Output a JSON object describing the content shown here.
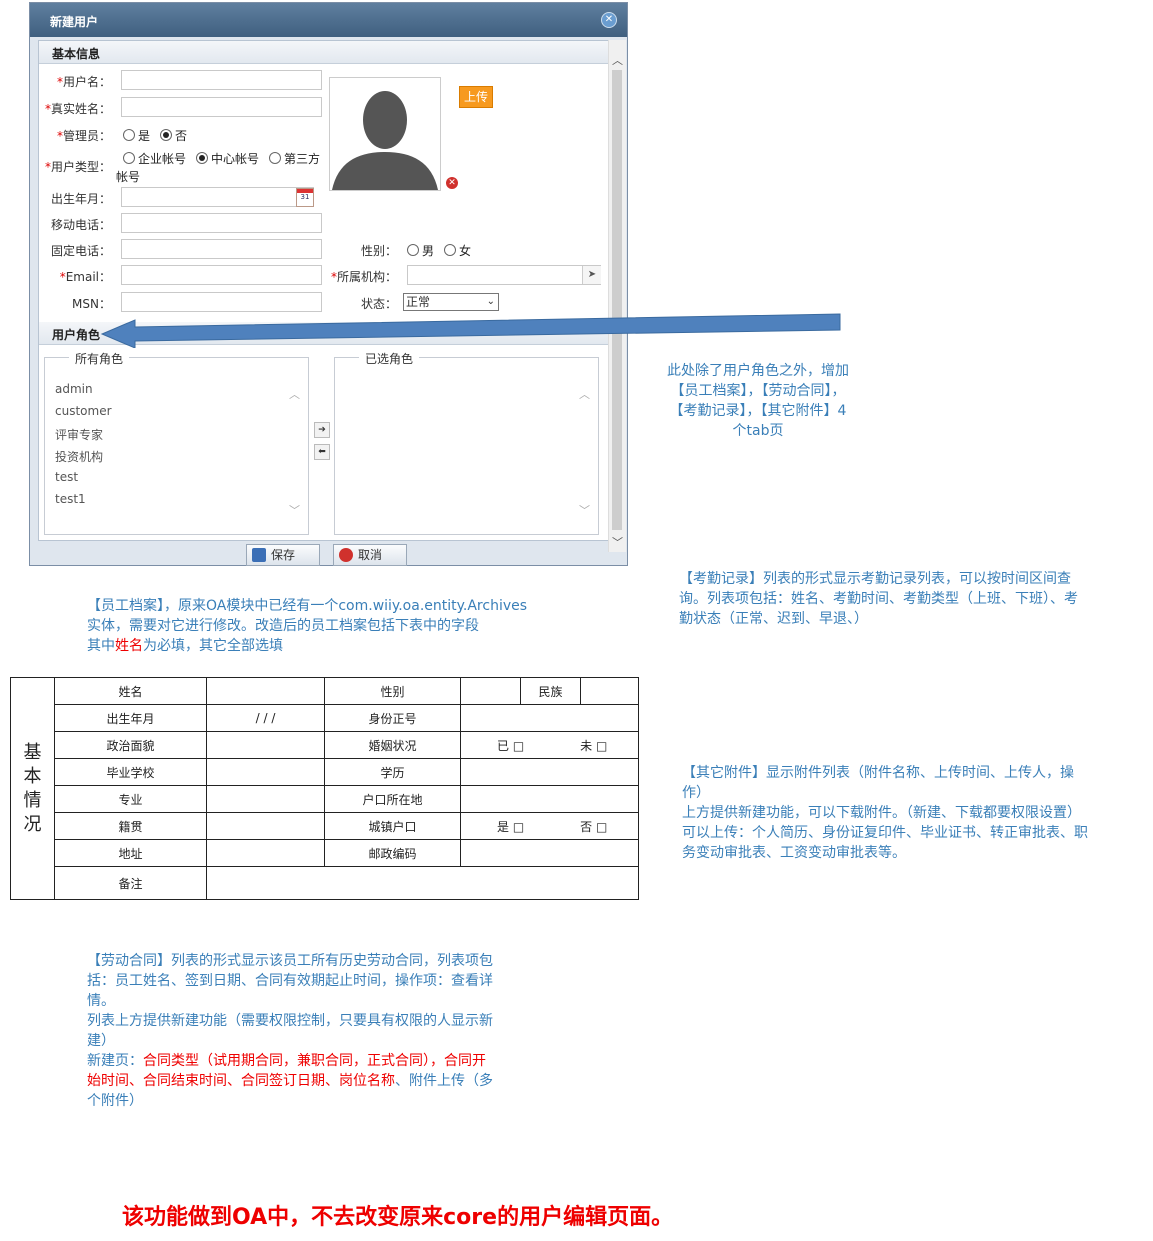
{
  "dialog": {
    "title": "新建用户",
    "section_basic": "基本信息",
    "section_roles": "用户角色",
    "fields": {
      "username": "用户名：",
      "realname": "真实姓名：",
      "admin": "管理员：",
      "admin_yes": "是",
      "admin_no": "否",
      "usertype": "用户类型：",
      "type_enterprise": "企业帐号",
      "type_center": "中心帐号",
      "type_third": "第三方",
      "type_third_cont": "帐号",
      "birth": "出生年月：",
      "mobile": "移动电话：",
      "phone": "固定电话：",
      "gender": "性别：",
      "gender_m": "男",
      "gender_f": "女",
      "email": "Email：",
      "org": "所属机构：",
      "msn": "MSN：",
      "status": "状态：",
      "status_value": "正常"
    },
    "upload_label": "上传",
    "all_roles_title": "所有角色",
    "selected_roles_title": "已选角色",
    "roles": [
      "admin",
      "customer",
      "评审专家",
      "投资机构",
      "test",
      "test1"
    ],
    "save_label": "保存",
    "cancel_label": "取消"
  },
  "notes": {
    "tabs_note": [
      "此处除了用户角色之外，增加",
      "【员工档案】，【劳动合同】，",
      "【考勤记录】，【其它附件】4",
      "个tab页"
    ],
    "archive_note_1": "【员工档案】，原来OA模块中已经有一个com.wiiy.oa.entity.Archives",
    "archive_note_2": "实体，需要对它进行修改。改造后的员工档案包括下表中的字段",
    "archive_note_3a": "其中",
    "archive_note_3b": "姓名",
    "archive_note_3c": "为必填，其它全部选填",
    "attendance_note": [
      "【考勤记录】列表的形式显示考勤记录列表，可以按时间区间查",
      "询。列表项包括：姓名、考勤时间、考勤类型（上班、下班）、考",
      "勤状态（正常、迟到、早退、）"
    ],
    "attach_note": [
      "【其它附件】显示附件列表（附件名称、上传时间、上传人，操",
      "作）",
      "上方提供新建功能，可以下载附件。（新建、下载都要权限设置）",
      "可以上传：个人简历、身份证复印件、毕业证书、转正审批表、职",
      "务变动审批表、工资变动审批表等。"
    ],
    "contract_note": [
      "【劳动合同】列表的形式显示该员工所有历史劳动合同，列表项包",
      "括：员工姓名、签到日期、合同有效期起止时间，操作项：查看详",
      "情。",
      "列表上方提供新建功能（需要权限控制，只要具有权限的人显示新",
      "建）"
    ],
    "contract_new_1": "新建页：",
    "contract_new_2": "合同类型（试用期合同，兼职合同，正式合同），合同开",
    "contract_new_3": "始时间、合同结束时间、合同签订日期、岗位名称",
    "contract_new_4": "、附件上传（多",
    "contract_new_5": "个附件）",
    "final": "该功能做到OA中，不去改变原来core的用户编辑页面。"
  },
  "archive_table": {
    "side_title": [
      "基",
      "本",
      "情",
      "况"
    ],
    "name": "姓名",
    "gender": "性别",
    "nation": "民族",
    "birth": "出生年月",
    "birth_value": "/   /   /",
    "idno": "身份正号",
    "politics": "政治面貌",
    "marital": "婚姻状况",
    "married": "已 □",
    "unmarried": "未 □",
    "school": "毕业学校",
    "education": "学历",
    "major": "专业",
    "hukou": "户口所在地",
    "native": "籍贯",
    "urban": "城镇户口",
    "yes": "是 □",
    "no": "否 □",
    "address": "地址",
    "postcode": "邮政编码",
    "remark": "备注"
  },
  "colors": {
    "accent_blue": "#3a7fb8",
    "red": "#e00000",
    "upload_orange": "#f79a1f",
    "arrow_blue": "#4f81bd"
  }
}
